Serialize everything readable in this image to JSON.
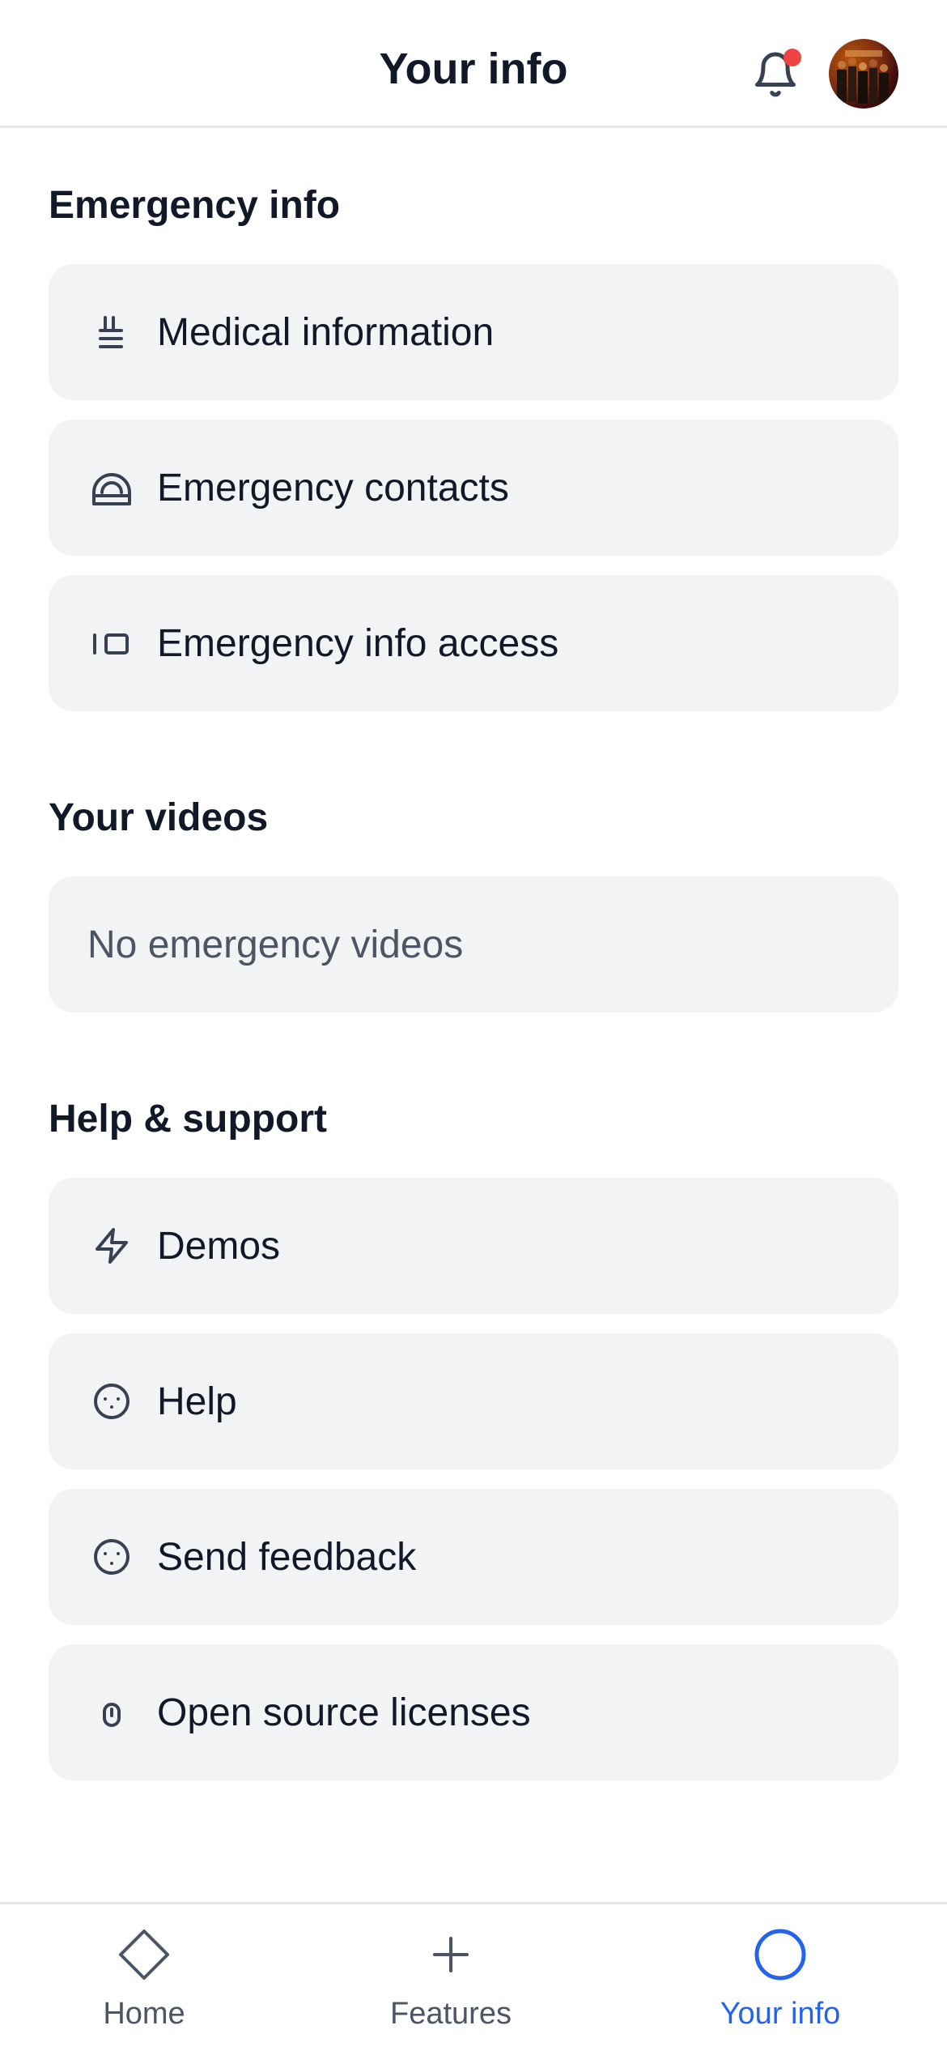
{
  "header": {
    "title": "Your info",
    "notification_dot_color": "#ef4444"
  },
  "sections": {
    "emergency": {
      "title": "Emergency info",
      "items": [
        {
          "label": "Medical information",
          "icon": "medical-icon"
        },
        {
          "label": "Emergency contacts",
          "icon": "contacts-icon"
        },
        {
          "label": "Emergency info access",
          "icon": "access-icon"
        }
      ]
    },
    "videos": {
      "title": "Your videos",
      "empty_text": "No emergency videos"
    },
    "help": {
      "title": "Help & support",
      "items": [
        {
          "label": "Demos",
          "icon": "lightning-icon"
        },
        {
          "label": "Help",
          "icon": "help-icon"
        },
        {
          "label": "Send feedback",
          "icon": "feedback-icon"
        },
        {
          "label": "Open source licenses",
          "icon": "license-icon"
        }
      ]
    }
  },
  "bottom_nav": {
    "items": [
      {
        "label": "Home",
        "icon": "diamond-icon",
        "active": false
      },
      {
        "label": "Features",
        "icon": "plus-icon",
        "active": false
      },
      {
        "label": "Your info",
        "icon": "circle-icon",
        "active": true
      }
    ],
    "active_color": "#2563eb"
  }
}
